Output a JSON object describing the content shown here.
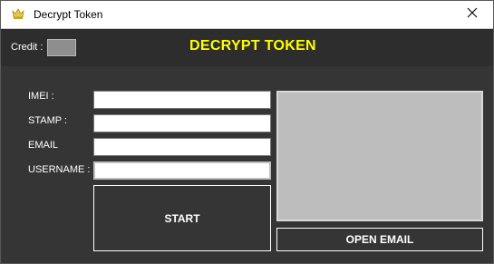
{
  "window": {
    "title": "Decrypt Token",
    "app_icon": "crown-icon",
    "close_icon": "close-icon"
  },
  "header": {
    "credit_label": "Credit :",
    "credit_value": "",
    "title": "DECRYPT TOKEN",
    "title_color": "#ffff00"
  },
  "form": {
    "fields": [
      {
        "label": "IMEI :",
        "value": ""
      },
      {
        "label": "STAMP :",
        "value": ""
      },
      {
        "label": "EMAIL",
        "value": ""
      },
      {
        "label": "USERNAME :",
        "value": ""
      }
    ],
    "start_label": "START"
  },
  "preview": {
    "open_email_label": "OPEN EMAIL"
  },
  "colors": {
    "background": "#353535",
    "header_background": "#2d2d2d",
    "preview_background": "#bdbdbd"
  }
}
